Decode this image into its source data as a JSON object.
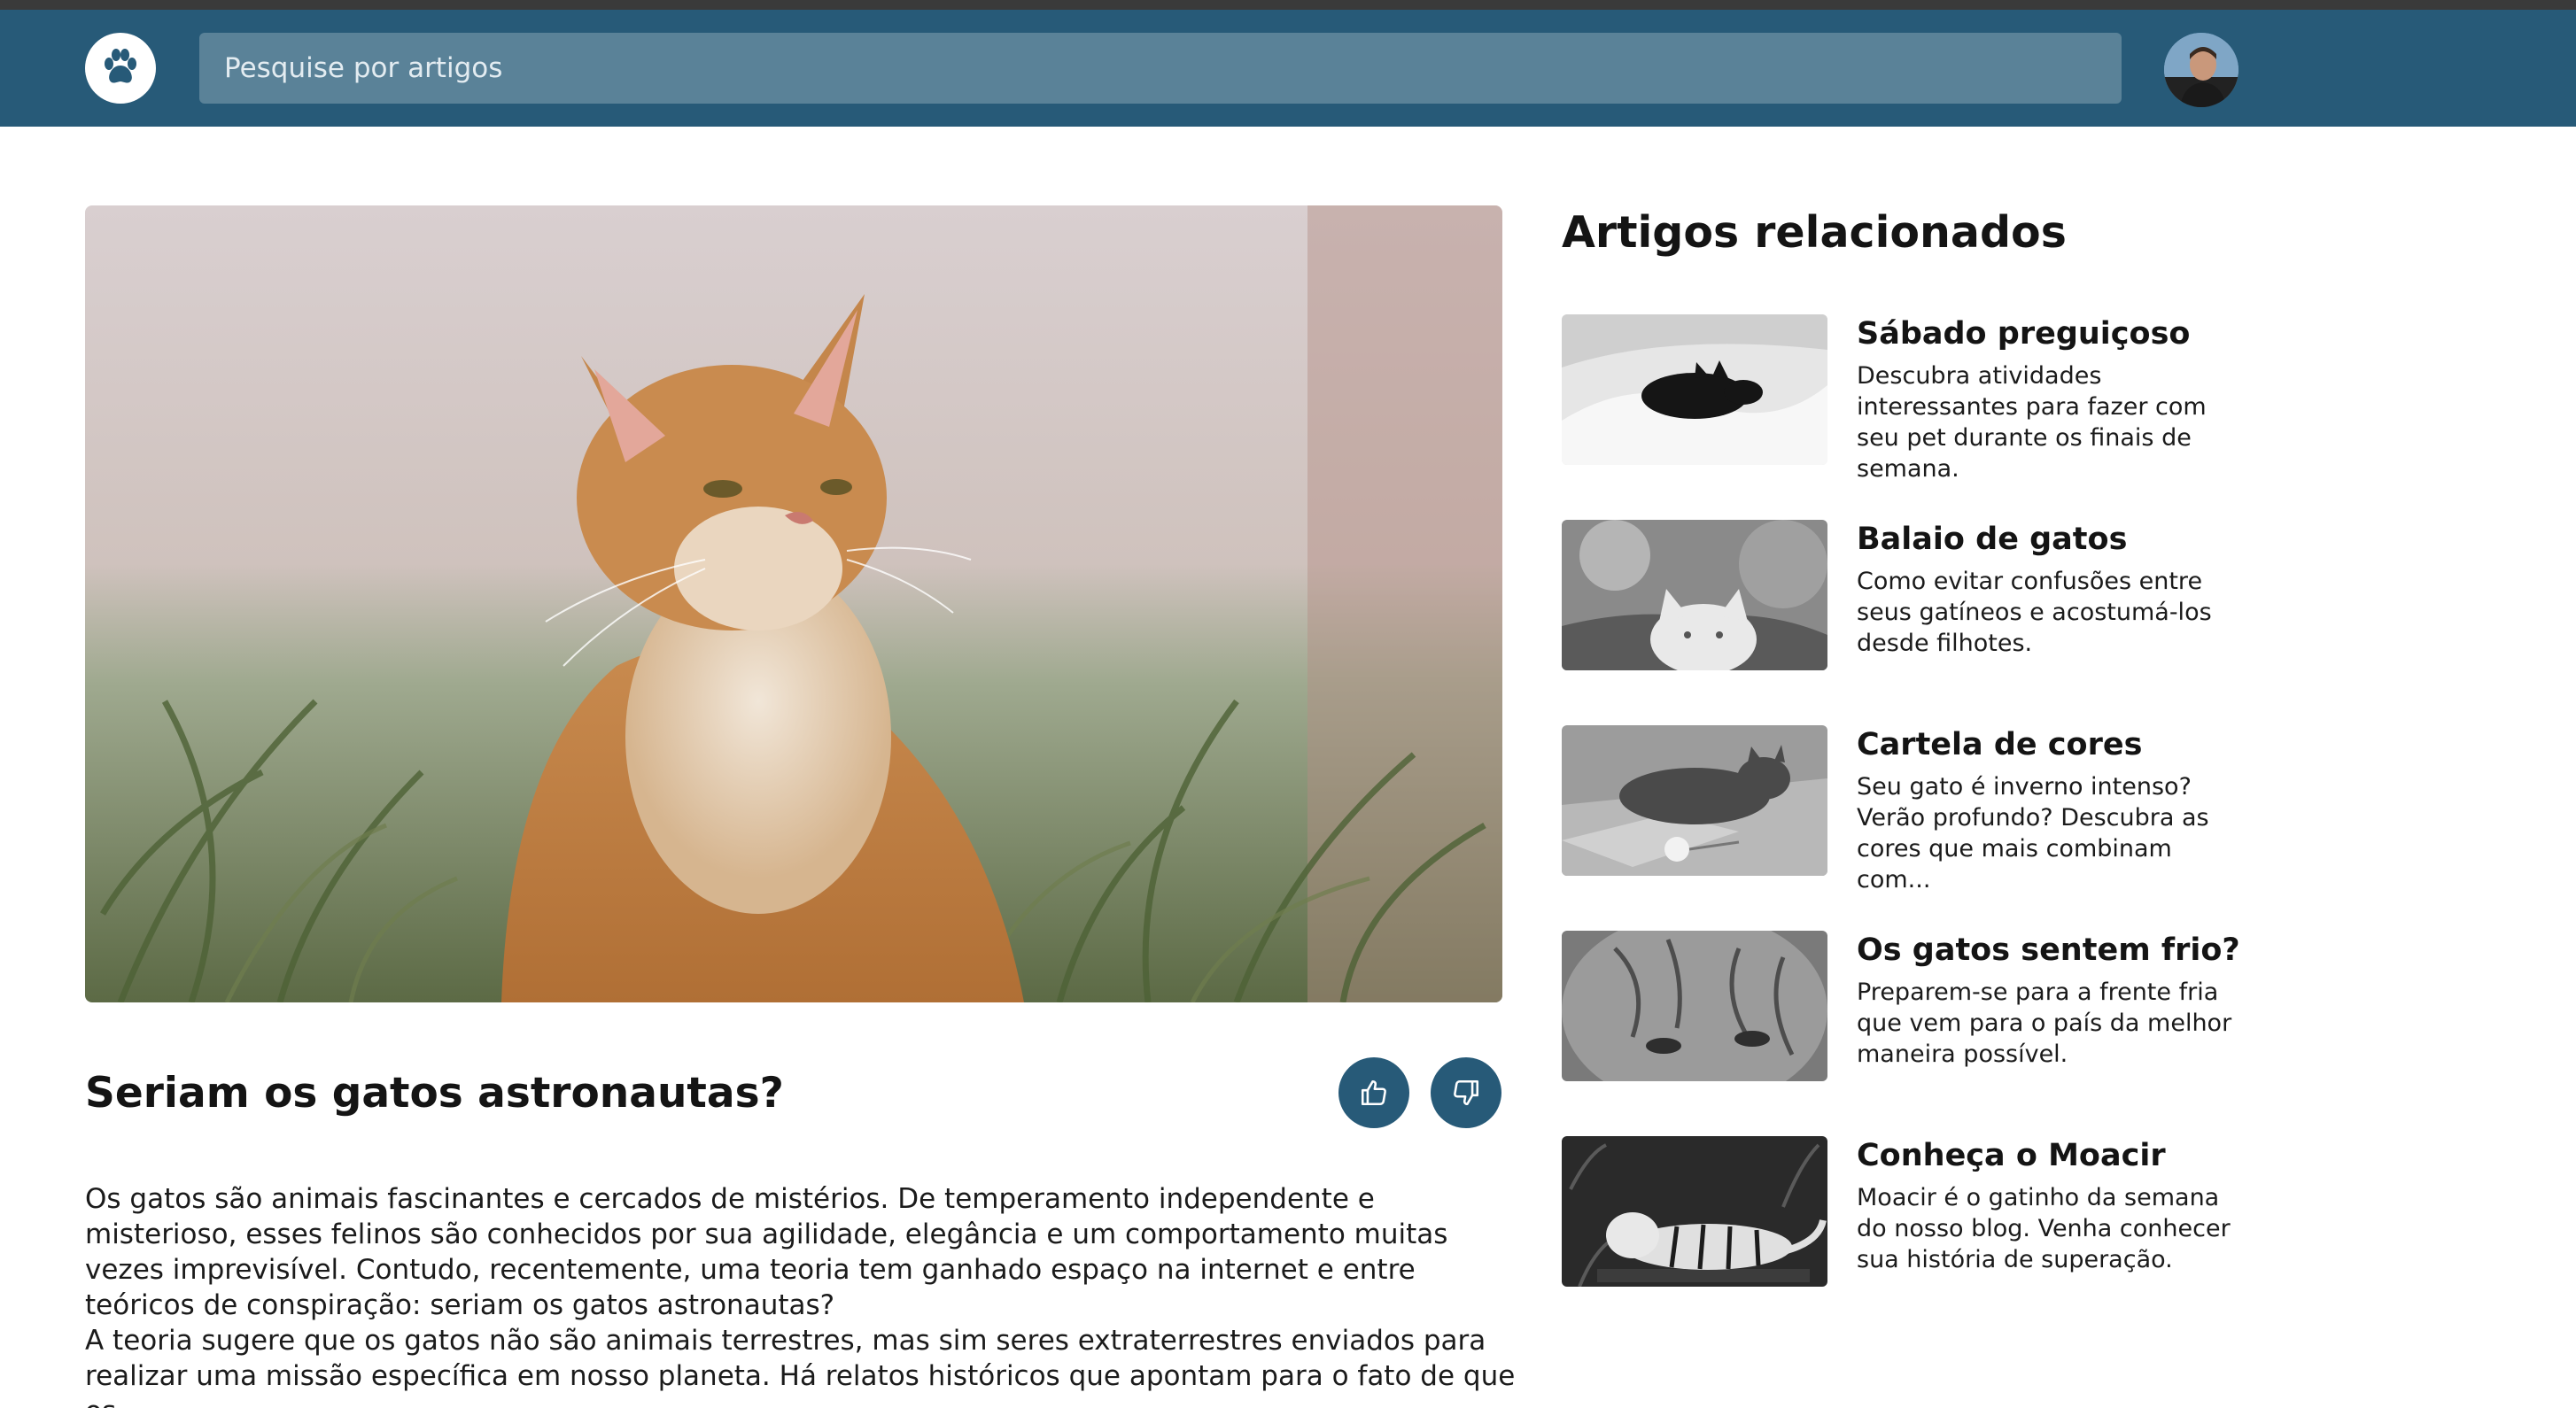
{
  "header": {
    "search_placeholder": "Pesquise por artigos",
    "logo_icon": "paw-icon",
    "avatar_icon": "user-avatar"
  },
  "article": {
    "title": "Seriam os gatos astronautas?",
    "like_icon": "thumbs-up-icon",
    "dislike_icon": "thumbs-down-icon",
    "paragraphs": [
      "Os gatos são animais fascinantes e cercados de mistérios. De temperamento independente e misterioso, esses felinos são conhecidos por sua agilidade, elegância e um comportamento muitas vezes imprevisível. Contudo, recentemente, uma teoria tem ganhado espaço na internet e entre teóricos de conspiração: seriam os gatos astronautas?",
      "A teoria sugere que os gatos não são animais terrestres, mas sim seres extraterrestres enviados para realizar uma missão específica em nosso planeta. Há relatos históricos que apontam para o fato de que os"
    ]
  },
  "related": {
    "title": "Artigos relacionados",
    "items": [
      {
        "title": "Sábado preguiçoso",
        "description": "Descubra atividades interessantes para fazer com seu pet durante os finais de semana."
      },
      {
        "title": "Balaio de gatos",
        "description": "Como evitar confusões entre seus gatíneos e acostumá-los desde filhotes."
      },
      {
        "title": "Cartela de cores",
        "description": "Seu gato é inverno intenso? Verão profundo? Descubra as cores que mais combinam com..."
      },
      {
        "title": "Os gatos sentem frio?",
        "description": "Preparem-se para a frente fria que vem para o país da melhor maneira possível."
      },
      {
        "title": "Conheça o Moacir",
        "description": "Moacir é o gatinho da semana do nosso blog. Venha conhecer sua história de superação."
      }
    ]
  },
  "colors": {
    "header_bg": "#275a78",
    "search_bg": "#5a8298",
    "button_bg": "#275a78"
  }
}
